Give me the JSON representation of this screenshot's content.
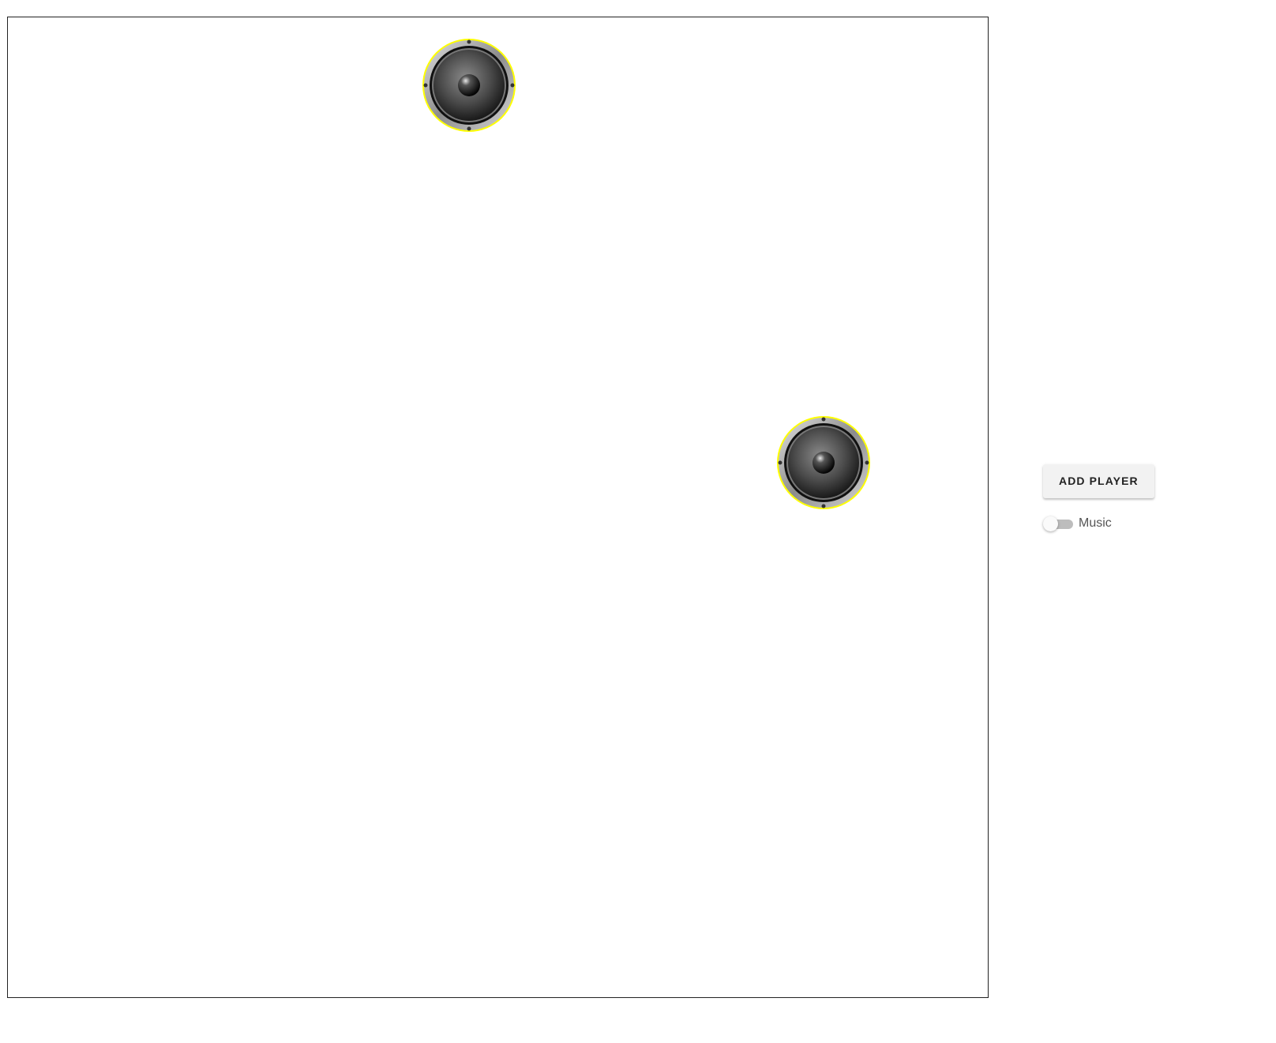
{
  "canvas": {
    "speakers": [
      {
        "icon": "speaker-icon",
        "highlight_color": "#ffff00"
      },
      {
        "icon": "speaker-icon",
        "highlight_color": "#ffff00"
      }
    ]
  },
  "controls": {
    "add_player_label": "ADD PLAYER",
    "music_toggle": {
      "label": "Music",
      "checked": false
    }
  },
  "colors": {
    "highlight": "#ffff00",
    "toggle_track_off": "#bdbdbd",
    "button_bg": "#f2f2f2"
  }
}
